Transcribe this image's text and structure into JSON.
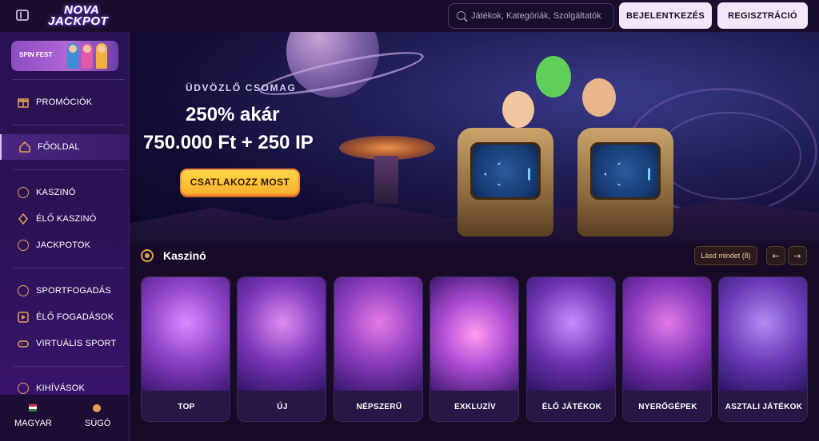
{
  "header": {
    "logo_line1": "NOVA",
    "logo_line2": "JACKPOT",
    "search_placeholder": "Játékok, Kategóriák, Szolgáltatók",
    "login_label": "BEJELENTKEZÉS",
    "register_label": "REGISZTRÁCIÓ"
  },
  "sidebar": {
    "promo_banner": "SPIN FEST",
    "items": [
      {
        "label": "PROMÓCIÓK",
        "icon": "gift-icon"
      },
      {
        "label": "FŐOLDAL",
        "icon": "home-icon",
        "active": true
      },
      {
        "label": "KASZINÓ",
        "icon": "casino-chip-icon"
      },
      {
        "label": "ÉLŐ KASZINÓ",
        "icon": "live-casino-icon"
      },
      {
        "label": "JACKPOTOK",
        "icon": "jackpot-icon"
      },
      {
        "label": "SPORTFOGADÁS",
        "icon": "sports-icon"
      },
      {
        "label": "ÉLŐ FOGADÁSOK",
        "icon": "live-bets-icon"
      },
      {
        "label": "VIRTUÁLIS SPORT",
        "icon": "gamepad-icon"
      },
      {
        "label": "KIHÍVÁSOK",
        "icon": "trophy-icon"
      }
    ],
    "footer": {
      "language_label": "MAGYAR",
      "help_label": "SÚGÓ"
    }
  },
  "hero": {
    "kicker": "ÜDVÖZLŐ CSOMAG",
    "line1": "250% akár",
    "line2": "750.000 Ft + 250 IP",
    "cta_label": "CSATLAKOZZ MOST"
  },
  "casino_section": {
    "title": "Kaszinó",
    "see_all_label": "Lásd mindet (8)",
    "prev_symbol": "←",
    "next_symbol": "→",
    "cards": [
      {
        "label": "TOP"
      },
      {
        "label": "ÚJ"
      },
      {
        "label": "NÉPSZERŰ"
      },
      {
        "label": "EXKLUZÍV"
      },
      {
        "label": "ÉLŐ JÁTÉKOK"
      },
      {
        "label": "NYERŐGÉPEK"
      },
      {
        "label": "ASZTALI JÁTÉKOK"
      }
    ]
  },
  "colors": {
    "accent": "#e0a050",
    "cta": "#f7b02a",
    "sidebar_bg": "#2a1352",
    "page_bg": "#160a26"
  }
}
